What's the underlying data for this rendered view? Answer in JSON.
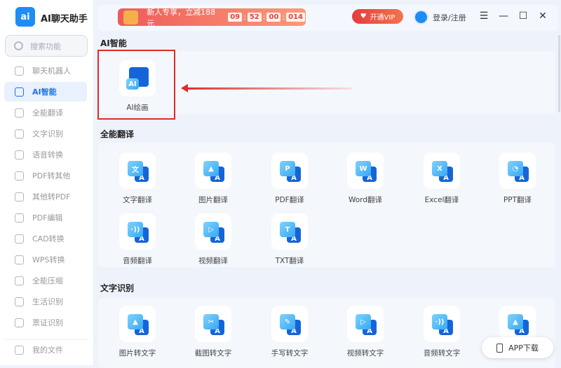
{
  "app": {
    "logo": "ai",
    "title": "AI聊天助手"
  },
  "search": {
    "placeholder": "搜索功能"
  },
  "sidebar": {
    "items": [
      {
        "label": "聊天机器人",
        "icon": "robot-icon"
      },
      {
        "label": "AI智能",
        "icon": "ai-icon",
        "active": true
      },
      {
        "label": "全能翻译",
        "icon": "translate-icon"
      },
      {
        "label": "文字识别",
        "icon": "ocr-icon"
      },
      {
        "label": "语音转换",
        "icon": "voice-icon"
      },
      {
        "label": "PDF转其他",
        "icon": "pdf-icon"
      },
      {
        "label": "其他转PDF",
        "icon": "to-pdf-icon"
      },
      {
        "label": "PDF编辑",
        "icon": "pdf-edit-icon"
      },
      {
        "label": "CAD转换",
        "icon": "cad-icon"
      },
      {
        "label": "WPS转换",
        "icon": "wps-icon"
      },
      {
        "label": "全能压缩",
        "icon": "compress-icon"
      },
      {
        "label": "生活识别",
        "icon": "scan-icon"
      },
      {
        "label": "票证识别",
        "icon": "ticket-icon"
      }
    ],
    "my_files": "我的文件"
  },
  "promo": {
    "text": "新人专享，立减188元",
    "countdown": [
      "09",
      "52",
      "00",
      "014"
    ]
  },
  "header": {
    "vip": "开通VIP",
    "login": "登录/注册"
  },
  "sections": [
    {
      "title": "AI智能",
      "tools": [
        {
          "label": "AI绘画",
          "glyph": "AI"
        }
      ]
    },
    {
      "title": "全能翻译",
      "tools": [
        {
          "label": "文字翻译",
          "glyph": "文"
        },
        {
          "label": "图片翻译",
          "glyph": "▲"
        },
        {
          "label": "PDF翻译",
          "glyph": "P"
        },
        {
          "label": "Word翻译",
          "glyph": "W"
        },
        {
          "label": "Excel翻译",
          "glyph": "X"
        },
        {
          "label": "PPT翻译",
          "glyph": "◔"
        },
        {
          "label": "音频翻译",
          "glyph": "·))"
        },
        {
          "label": "视频翻译",
          "glyph": "▷"
        },
        {
          "label": "TXT翻译",
          "glyph": "T"
        }
      ]
    },
    {
      "title": "文字识别",
      "tools": [
        {
          "label": "图片转文字",
          "glyph": "▲"
        },
        {
          "label": "截图转文字",
          "glyph": "✂"
        },
        {
          "label": "手写转文字",
          "glyph": "✎"
        },
        {
          "label": "视频转文字",
          "glyph": "▷"
        },
        {
          "label": "音频转文字",
          "glyph": "·))"
        },
        {
          "label": "",
          "glyph": "▲"
        }
      ]
    }
  ],
  "app_download": "APP下载"
}
